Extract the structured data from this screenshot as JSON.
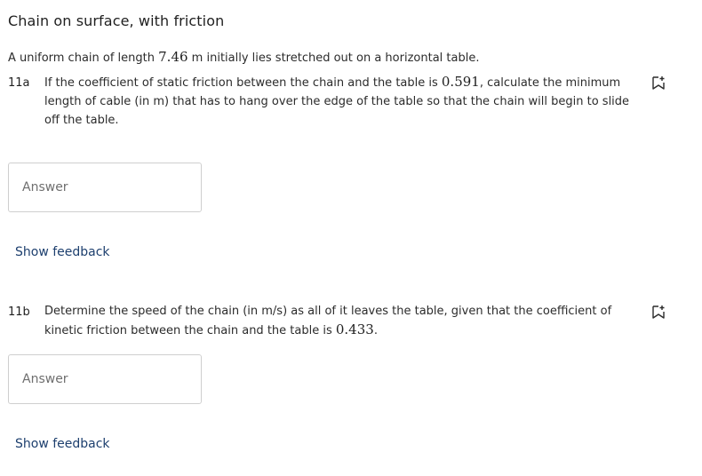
{
  "title": "Chain on surface, with friction",
  "intro": {
    "before": "A uniform chain of length ",
    "length_value": "7.46",
    "after": " m initially lies stretched out on a horizontal table."
  },
  "questions": [
    {
      "label": "11a",
      "text_before": "If the coefficient of static friction between the chain and the table is ",
      "value": "0.591",
      "text_after": ", calculate the minimum length of cable (in m) that has to hang over the edge of the table so that the chain will begin to slide off the table.",
      "answer_placeholder": "Answer",
      "feedback_label": "Show feedback",
      "icon": "bookmark-add-icon"
    },
    {
      "label": "11b",
      "text_before": "Determine the speed of the chain (in m/s) as all of it leaves the table, given that the coefficient of kinetic friction between the chain and the table is ",
      "value": "0.433",
      "text_after": ".",
      "answer_placeholder": "Answer",
      "feedback_label": "Show feedback",
      "icon": "bookmark-add-icon"
    }
  ],
  "colors": {
    "link": "#1d3f6e",
    "border": "#cfcfcf",
    "text": "#2b2b2b"
  }
}
